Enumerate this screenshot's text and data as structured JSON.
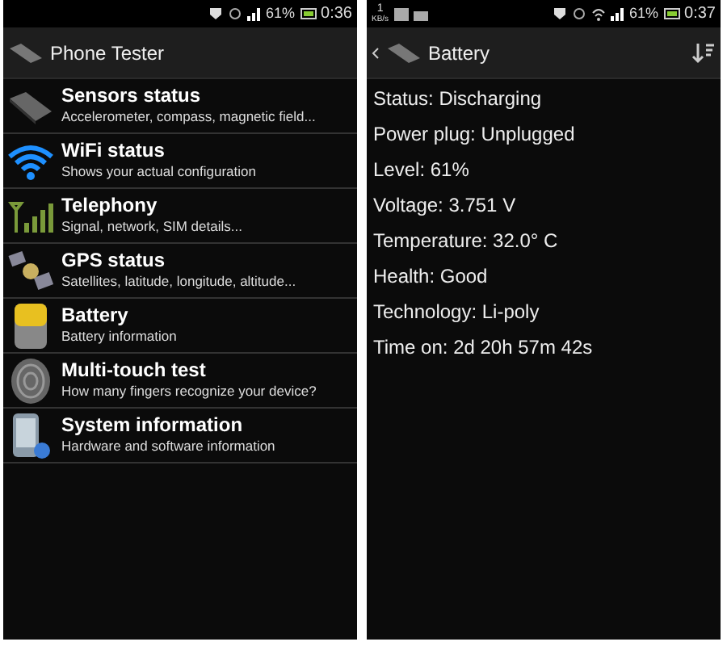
{
  "screens": [
    {
      "status_bar": {
        "battery": "61%",
        "time": "0:36"
      },
      "action_bar": {
        "title": "Phone Tester",
        "back": false,
        "sort": false
      },
      "list": [
        {
          "title": "Sensors status",
          "subtitle": "Accelerometer, compass, magnetic field..."
        },
        {
          "title": "WiFi status",
          "subtitle": "Shows your actual configuration"
        },
        {
          "title": "Telephony",
          "subtitle": "Signal, network, SIM details..."
        },
        {
          "title": "GPS status",
          "subtitle": "Satellites, latitude, longitude, altitude..."
        },
        {
          "title": "Battery",
          "subtitle": "Battery information"
        },
        {
          "title": "Multi-touch test",
          "subtitle": "How many fingers recognize your device?"
        },
        {
          "title": "System information",
          "subtitle": "Hardware and software information"
        }
      ]
    },
    {
      "status_bar": {
        "left_texts": [
          "1",
          "KB/s"
        ],
        "battery": "61%",
        "time": "0:37"
      },
      "action_bar": {
        "title": "Battery",
        "back": true,
        "sort": true
      },
      "lines": [
        "Status: Discharging",
        "Power plug: Unplugged",
        "Level: 61%",
        "Voltage: 3.751 V",
        "Temperature: 32.0° C",
        "Health: Good",
        "Technology: Li-poly",
        "Time on: 2d 20h 57m 42s"
      ]
    }
  ]
}
